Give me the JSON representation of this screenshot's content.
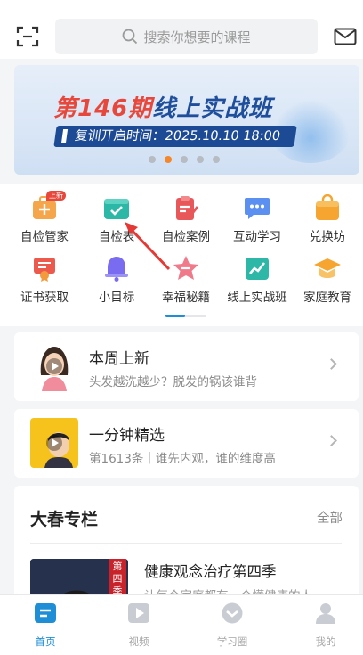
{
  "search": {
    "placeholder": "搜索你想要的课程"
  },
  "banner": {
    "title_red": "第146期",
    "title_blue": "线上实战班",
    "subtitle": "复训开启时间：2025.10.10 18:00",
    "page_count": 5,
    "active_page": 2
  },
  "grid": {
    "items": [
      {
        "label": "自检管家",
        "icon": "toolbox-icon",
        "badge": "上新"
      },
      {
        "label": "自检表",
        "icon": "checklist-icon"
      },
      {
        "label": "自检案例",
        "icon": "clipboard-edit-icon"
      },
      {
        "label": "互动学习",
        "icon": "chat-bubble-icon"
      },
      {
        "label": "兑换坊",
        "icon": "shopping-bag-icon"
      },
      {
        "label": "证书获取",
        "icon": "certificate-icon"
      },
      {
        "label": "小目标",
        "icon": "bell-icon"
      },
      {
        "label": "幸福秘籍",
        "icon": "star-smile-icon"
      },
      {
        "label": "线上实战班",
        "icon": "trend-chart-icon"
      },
      {
        "label": "家庭教育",
        "icon": "graduation-cap-icon"
      }
    ]
  },
  "cards": [
    {
      "title": "本周上新",
      "subtitle": "头发越洗越少？脱发的锅该谁背"
    },
    {
      "title": "一分钟精选",
      "subtitle": "第1613条｜谁先内观，谁的维度高"
    }
  ],
  "column": {
    "title": "大春专栏",
    "more": "全部",
    "item_title": "健康观念治疗第四季",
    "item_subtitle": "让每个家庭都有一个懂健康的人",
    "thumb_tag": "第四季"
  },
  "tabs": [
    {
      "label": "首页",
      "active": true
    },
    {
      "label": "视频"
    },
    {
      "label": "学习圈"
    },
    {
      "label": "我的"
    }
  ],
  "colors": {
    "accent": "#1e8fd6",
    "banner_red": "#e8483c",
    "banner_blue": "#1f4f9c",
    "dot_active": "#f5872a"
  }
}
